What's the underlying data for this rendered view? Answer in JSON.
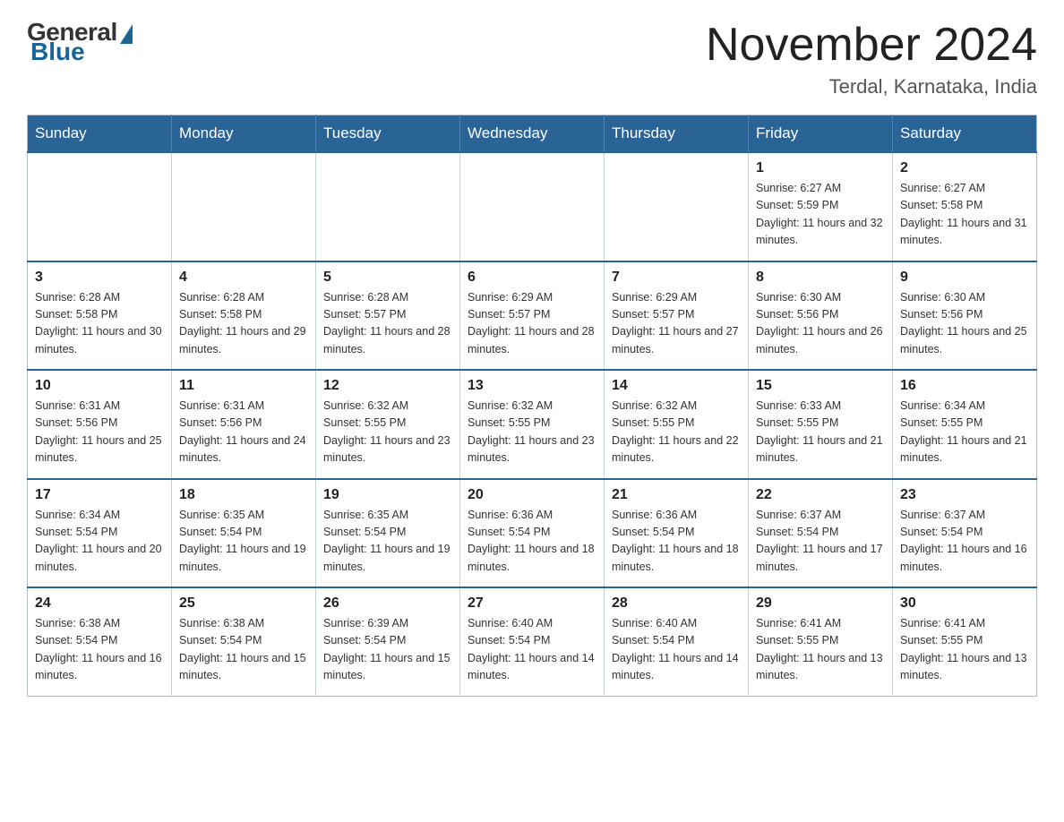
{
  "header": {
    "logo_general": "General",
    "logo_blue": "Blue",
    "month_title": "November 2024",
    "location": "Terdal, Karnataka, India"
  },
  "weekdays": [
    "Sunday",
    "Monday",
    "Tuesday",
    "Wednesday",
    "Thursday",
    "Friday",
    "Saturday"
  ],
  "weeks": [
    [
      {
        "day": "",
        "sunrise": "",
        "sunset": "",
        "daylight": "",
        "empty": true
      },
      {
        "day": "",
        "sunrise": "",
        "sunset": "",
        "daylight": "",
        "empty": true
      },
      {
        "day": "",
        "sunrise": "",
        "sunset": "",
        "daylight": "",
        "empty": true
      },
      {
        "day": "",
        "sunrise": "",
        "sunset": "",
        "daylight": "",
        "empty": true
      },
      {
        "day": "",
        "sunrise": "",
        "sunset": "",
        "daylight": "",
        "empty": true
      },
      {
        "day": "1",
        "sunrise": "Sunrise: 6:27 AM",
        "sunset": "Sunset: 5:59 PM",
        "daylight": "Daylight: 11 hours and 32 minutes.",
        "empty": false
      },
      {
        "day": "2",
        "sunrise": "Sunrise: 6:27 AM",
        "sunset": "Sunset: 5:58 PM",
        "daylight": "Daylight: 11 hours and 31 minutes.",
        "empty": false
      }
    ],
    [
      {
        "day": "3",
        "sunrise": "Sunrise: 6:28 AM",
        "sunset": "Sunset: 5:58 PM",
        "daylight": "Daylight: 11 hours and 30 minutes.",
        "empty": false
      },
      {
        "day": "4",
        "sunrise": "Sunrise: 6:28 AM",
        "sunset": "Sunset: 5:58 PM",
        "daylight": "Daylight: 11 hours and 29 minutes.",
        "empty": false
      },
      {
        "day": "5",
        "sunrise": "Sunrise: 6:28 AM",
        "sunset": "Sunset: 5:57 PM",
        "daylight": "Daylight: 11 hours and 28 minutes.",
        "empty": false
      },
      {
        "day": "6",
        "sunrise": "Sunrise: 6:29 AM",
        "sunset": "Sunset: 5:57 PM",
        "daylight": "Daylight: 11 hours and 28 minutes.",
        "empty": false
      },
      {
        "day": "7",
        "sunrise": "Sunrise: 6:29 AM",
        "sunset": "Sunset: 5:57 PM",
        "daylight": "Daylight: 11 hours and 27 minutes.",
        "empty": false
      },
      {
        "day": "8",
        "sunrise": "Sunrise: 6:30 AM",
        "sunset": "Sunset: 5:56 PM",
        "daylight": "Daylight: 11 hours and 26 minutes.",
        "empty": false
      },
      {
        "day": "9",
        "sunrise": "Sunrise: 6:30 AM",
        "sunset": "Sunset: 5:56 PM",
        "daylight": "Daylight: 11 hours and 25 minutes.",
        "empty": false
      }
    ],
    [
      {
        "day": "10",
        "sunrise": "Sunrise: 6:31 AM",
        "sunset": "Sunset: 5:56 PM",
        "daylight": "Daylight: 11 hours and 25 minutes.",
        "empty": false
      },
      {
        "day": "11",
        "sunrise": "Sunrise: 6:31 AM",
        "sunset": "Sunset: 5:56 PM",
        "daylight": "Daylight: 11 hours and 24 minutes.",
        "empty": false
      },
      {
        "day": "12",
        "sunrise": "Sunrise: 6:32 AM",
        "sunset": "Sunset: 5:55 PM",
        "daylight": "Daylight: 11 hours and 23 minutes.",
        "empty": false
      },
      {
        "day": "13",
        "sunrise": "Sunrise: 6:32 AM",
        "sunset": "Sunset: 5:55 PM",
        "daylight": "Daylight: 11 hours and 23 minutes.",
        "empty": false
      },
      {
        "day": "14",
        "sunrise": "Sunrise: 6:32 AM",
        "sunset": "Sunset: 5:55 PM",
        "daylight": "Daylight: 11 hours and 22 minutes.",
        "empty": false
      },
      {
        "day": "15",
        "sunrise": "Sunrise: 6:33 AM",
        "sunset": "Sunset: 5:55 PM",
        "daylight": "Daylight: 11 hours and 21 minutes.",
        "empty": false
      },
      {
        "day": "16",
        "sunrise": "Sunrise: 6:34 AM",
        "sunset": "Sunset: 5:55 PM",
        "daylight": "Daylight: 11 hours and 21 minutes.",
        "empty": false
      }
    ],
    [
      {
        "day": "17",
        "sunrise": "Sunrise: 6:34 AM",
        "sunset": "Sunset: 5:54 PM",
        "daylight": "Daylight: 11 hours and 20 minutes.",
        "empty": false
      },
      {
        "day": "18",
        "sunrise": "Sunrise: 6:35 AM",
        "sunset": "Sunset: 5:54 PM",
        "daylight": "Daylight: 11 hours and 19 minutes.",
        "empty": false
      },
      {
        "day": "19",
        "sunrise": "Sunrise: 6:35 AM",
        "sunset": "Sunset: 5:54 PM",
        "daylight": "Daylight: 11 hours and 19 minutes.",
        "empty": false
      },
      {
        "day": "20",
        "sunrise": "Sunrise: 6:36 AM",
        "sunset": "Sunset: 5:54 PM",
        "daylight": "Daylight: 11 hours and 18 minutes.",
        "empty": false
      },
      {
        "day": "21",
        "sunrise": "Sunrise: 6:36 AM",
        "sunset": "Sunset: 5:54 PM",
        "daylight": "Daylight: 11 hours and 18 minutes.",
        "empty": false
      },
      {
        "day": "22",
        "sunrise": "Sunrise: 6:37 AM",
        "sunset": "Sunset: 5:54 PM",
        "daylight": "Daylight: 11 hours and 17 minutes.",
        "empty": false
      },
      {
        "day": "23",
        "sunrise": "Sunrise: 6:37 AM",
        "sunset": "Sunset: 5:54 PM",
        "daylight": "Daylight: 11 hours and 16 minutes.",
        "empty": false
      }
    ],
    [
      {
        "day": "24",
        "sunrise": "Sunrise: 6:38 AM",
        "sunset": "Sunset: 5:54 PM",
        "daylight": "Daylight: 11 hours and 16 minutes.",
        "empty": false
      },
      {
        "day": "25",
        "sunrise": "Sunrise: 6:38 AM",
        "sunset": "Sunset: 5:54 PM",
        "daylight": "Daylight: 11 hours and 15 minutes.",
        "empty": false
      },
      {
        "day": "26",
        "sunrise": "Sunrise: 6:39 AM",
        "sunset": "Sunset: 5:54 PM",
        "daylight": "Daylight: 11 hours and 15 minutes.",
        "empty": false
      },
      {
        "day": "27",
        "sunrise": "Sunrise: 6:40 AM",
        "sunset": "Sunset: 5:54 PM",
        "daylight": "Daylight: 11 hours and 14 minutes.",
        "empty": false
      },
      {
        "day": "28",
        "sunrise": "Sunrise: 6:40 AM",
        "sunset": "Sunset: 5:54 PM",
        "daylight": "Daylight: 11 hours and 14 minutes.",
        "empty": false
      },
      {
        "day": "29",
        "sunrise": "Sunrise: 6:41 AM",
        "sunset": "Sunset: 5:55 PM",
        "daylight": "Daylight: 11 hours and 13 minutes.",
        "empty": false
      },
      {
        "day": "30",
        "sunrise": "Sunrise: 6:41 AM",
        "sunset": "Sunset: 5:55 PM",
        "daylight": "Daylight: 11 hours and 13 minutes.",
        "empty": false
      }
    ]
  ]
}
